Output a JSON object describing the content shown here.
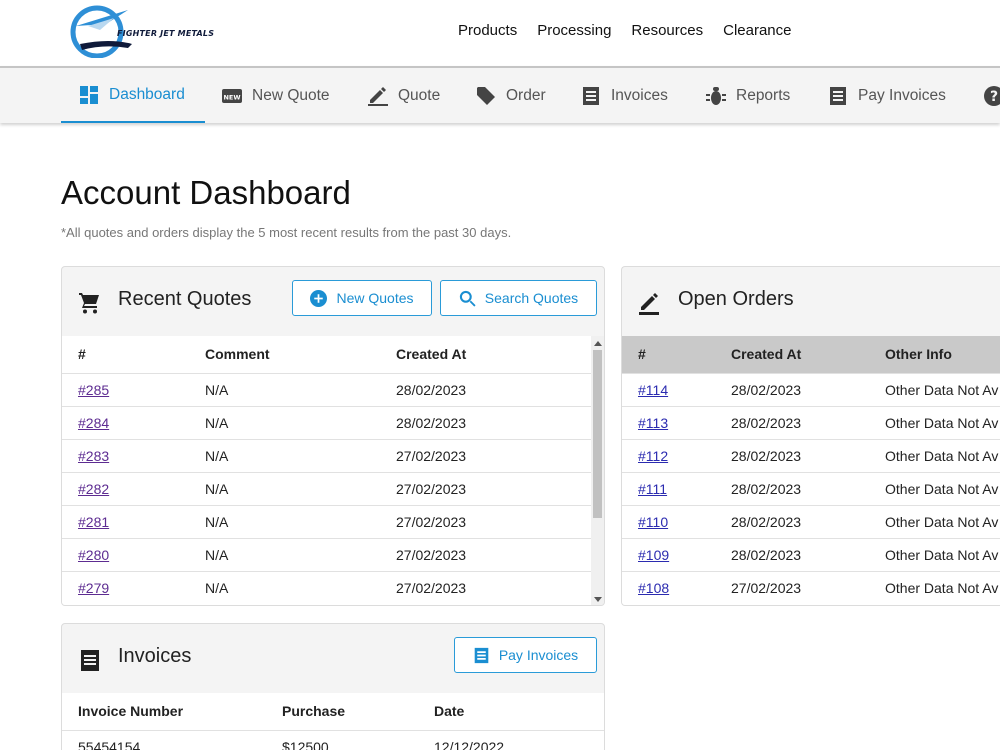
{
  "brand": {
    "name": "FIGHTER JET METALS"
  },
  "top_nav": [
    "Products",
    "Processing",
    "Resources",
    "Clearance"
  ],
  "tabs": [
    {
      "label": "Dashboard",
      "icon": "dashboard-icon",
      "active": true
    },
    {
      "label": "New Quote",
      "icon": "new-badge-icon"
    },
    {
      "label": "Quote",
      "icon": "pencil-icon"
    },
    {
      "label": "Order",
      "icon": "tag-icon"
    },
    {
      "label": "Invoices",
      "icon": "receipt-icon"
    },
    {
      "label": "Reports",
      "icon": "bug-icon"
    },
    {
      "label": "Pay Invoices",
      "icon": "receipt-icon"
    },
    {
      "label": "",
      "icon": "help-icon"
    }
  ],
  "page": {
    "title": "Account Dashboard",
    "note": "*All quotes and orders display the 5 most recent results from the past 30 days."
  },
  "recent_quotes": {
    "title": "Recent Quotes",
    "new_button": "New Quotes",
    "search_button": "Search Quotes",
    "columns": [
      "#",
      "Comment",
      "Created At"
    ],
    "rows": [
      [
        "#285",
        "N/A",
        "28/02/2023"
      ],
      [
        "#284",
        "N/A",
        "28/02/2023"
      ],
      [
        "#283",
        "N/A",
        "27/02/2023"
      ],
      [
        "#282",
        "N/A",
        "27/02/2023"
      ],
      [
        "#281",
        "N/A",
        "27/02/2023"
      ],
      [
        "#280",
        "N/A",
        "27/02/2023"
      ],
      [
        "#279",
        "N/A",
        "27/02/2023"
      ]
    ]
  },
  "open_orders": {
    "title": "Open Orders",
    "columns": [
      "#",
      "Created At",
      "Other Info"
    ],
    "rows": [
      [
        "#114",
        "28/02/2023",
        "Other Data Not Av"
      ],
      [
        "#113",
        "28/02/2023",
        "Other Data Not Av"
      ],
      [
        "#112",
        "28/02/2023",
        "Other Data Not Av"
      ],
      [
        "#111",
        "28/02/2023",
        "Other Data Not Av"
      ],
      [
        "#110",
        "28/02/2023",
        "Other Data Not Av"
      ],
      [
        "#109",
        "28/02/2023",
        "Other Data Not Av"
      ],
      [
        "#108",
        "27/02/2023",
        "Other Data Not Av"
      ]
    ]
  },
  "invoices": {
    "title": "Invoices",
    "pay_button": "Pay Invoices",
    "columns": [
      "Invoice Number",
      "Purchase",
      "Date"
    ],
    "rows": [
      [
        "55454154",
        "$12500",
        "12/12/2022"
      ]
    ]
  }
}
